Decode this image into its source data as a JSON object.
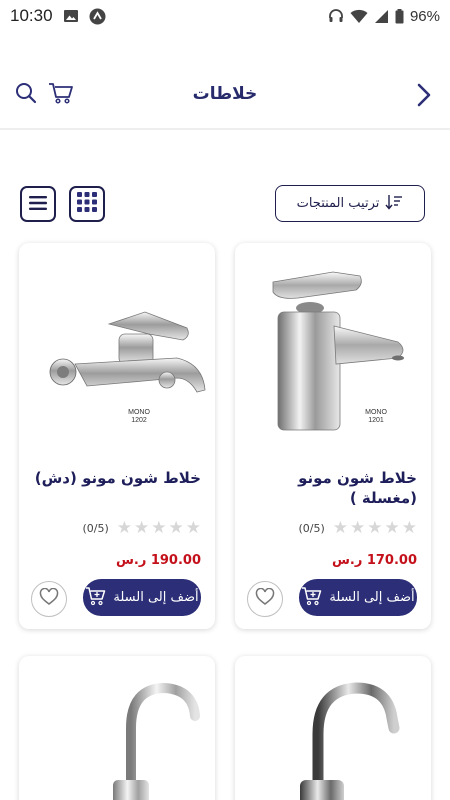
{
  "status_bar": {
    "time": "10:30",
    "battery": "96%",
    "icons": [
      "image-icon",
      "app-notification-icon",
      "headphones-icon",
      "wifi-icon",
      "signal-icon",
      "battery-icon"
    ]
  },
  "header": {
    "title": "خلاطات",
    "icons": [
      "cart-icon",
      "search-icon",
      "back-chevron-icon"
    ]
  },
  "toolbar": {
    "sort_label": "ترتيب المنتجات",
    "view_modes": [
      "list-view-icon",
      "grid-view-icon"
    ]
  },
  "products": [
    {
      "name": "خلاط شون مونو (مغسلة )",
      "model_label": "MONO\n1201",
      "rating_text": "(0/5)",
      "rating": 0,
      "price": "170.00 ر.س",
      "add_to_cart_label": "أضف إلى السلة"
    },
    {
      "name": "خلاط شون مونو (دش)",
      "model_label": "MONO\n1202",
      "rating_text": "(0/5)",
      "rating": 0,
      "price": "190.00 ر.س",
      "add_to_cart_label": "أضف إلى السلة"
    },
    {
      "name": "",
      "image": "faucet-image"
    },
    {
      "name": "",
      "image": "faucet-image"
    }
  ],
  "colors": {
    "brand": "#2c2f77",
    "price": "#c4101a",
    "star_empty": "#d7d7d7"
  }
}
